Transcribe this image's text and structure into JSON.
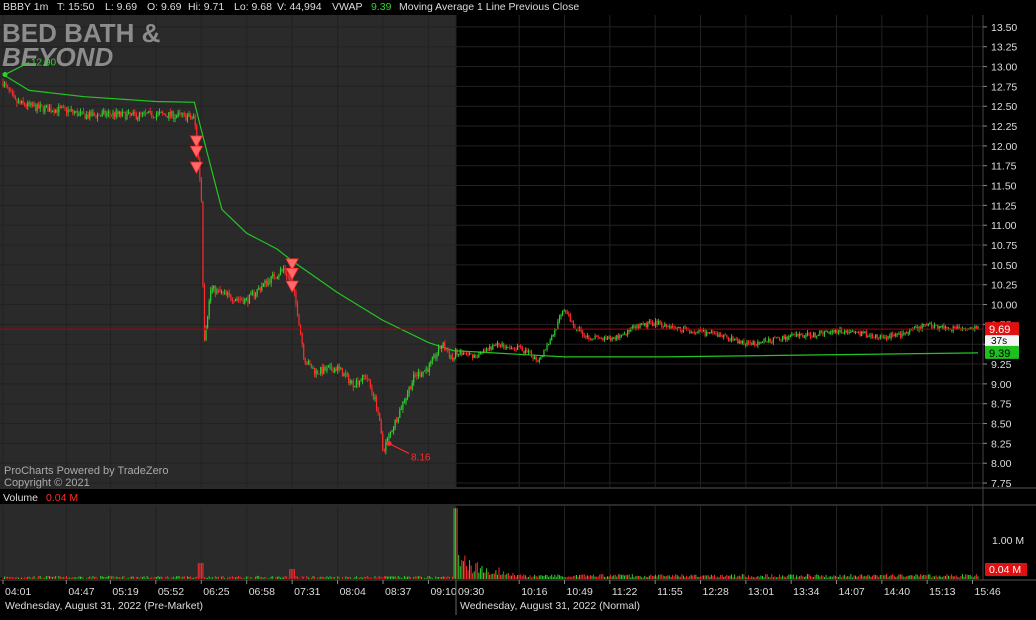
{
  "header": {
    "symbol": "BBBY 1m",
    "time": "T: 15:50",
    "low": "L: 9.69",
    "open": "O: 9.69",
    "high": "Hi: 9.71",
    "low2": "Lo: 9.68",
    "volume": "V: 44,994",
    "vwap_label": "VWAP",
    "vwap_value": "9.39",
    "indicators": "Moving Average 1 Line  Previous Close"
  },
  "logo": {
    "line1": "BED BATH &",
    "line2": "BEYOND"
  },
  "watermark": {
    "line1": "ProCharts Powered by TradeZero",
    "line2": "Copyright © 2021"
  },
  "volume_panel": {
    "label": "Volume",
    "value": "0.04 M",
    "axis_label": "1.00 M",
    "badge": "0.04 M"
  },
  "sessions": {
    "premarket": "Wednesday, August 31, 2022 (Pre-Market)",
    "normal": "Wednesday, August 31, 2022 (Normal)"
  },
  "price_badges": {
    "last": "9.69",
    "timer": "37s",
    "vwap": "9.39"
  },
  "annotations": {
    "high": "12.90",
    "low": "8.16"
  },
  "colors": {
    "up": "#2fd12f",
    "down": "#ff2b2b",
    "vwap": "#22c622",
    "premarket_bg": "#2a2a2a",
    "grid": "#222222",
    "last_line": "#b30000"
  },
  "chart_data": {
    "type": "candlestick",
    "x_ticks": [
      "04:01",
      "04:47",
      "05:19",
      "05:52",
      "06:25",
      "06:58",
      "07:31",
      "08:04",
      "08:37",
      "09:10",
      "09:30",
      "10:16",
      "10:49",
      "11:22",
      "11:55",
      "12:28",
      "13:01",
      "13:34",
      "14:07",
      "14:40",
      "15:13",
      "15:46"
    ],
    "y_ticks": [
      "13.50",
      "13.25",
      "13.00",
      "12.75",
      "12.50",
      "12.25",
      "12.00",
      "11.75",
      "11.50",
      "11.25",
      "11.00",
      "10.75",
      "10.50",
      "10.25",
      "10.00",
      "9.75",
      "9.50",
      "9.25",
      "9.00",
      "8.75",
      "8.50",
      "8.25",
      "8.00",
      "7.75"
    ],
    "ylim": [
      7.7,
      13.65
    ],
    "series": [
      {
        "name": "Price",
        "points": [
          [
            "04:01",
            12.8
          ],
          [
            "04:10",
            12.55
          ],
          [
            "04:25",
            12.48
          ],
          [
            "04:47",
            12.45
          ],
          [
            "05:00",
            12.38
          ],
          [
            "05:19",
            12.4
          ],
          [
            "05:35",
            12.38
          ],
          [
            "05:52",
            12.4
          ],
          [
            "06:10",
            12.38
          ],
          [
            "06:20",
            12.35
          ],
          [
            "06:23",
            11.8
          ],
          [
            "06:25",
            11.4
          ],
          [
            "06:27",
            9.55
          ],
          [
            "06:32",
            10.2
          ],
          [
            "06:45",
            10.1
          ],
          [
            "06:58",
            10.05
          ],
          [
            "07:10",
            10.25
          ],
          [
            "07:25",
            10.45
          ],
          [
            "07:31",
            10.25
          ],
          [
            "07:35",
            9.9
          ],
          [
            "07:40",
            9.3
          ],
          [
            "07:48",
            9.15
          ],
          [
            "08:04",
            9.2
          ],
          [
            "08:15",
            9.0
          ],
          [
            "08:25",
            9.1
          ],
          [
            "08:33",
            8.7
          ],
          [
            "08:37",
            8.16
          ],
          [
            "08:50",
            8.7
          ],
          [
            "09:00",
            9.1
          ],
          [
            "09:10",
            9.2
          ],
          [
            "09:20",
            9.5
          ],
          [
            "09:28",
            9.3
          ],
          [
            "09:30",
            9.4
          ],
          [
            "09:45",
            9.35
          ],
          [
            "10:00",
            9.5
          ],
          [
            "10:16",
            9.45
          ],
          [
            "10:30",
            9.3
          ],
          [
            "10:40",
            9.6
          ],
          [
            "10:49",
            9.95
          ],
          [
            "10:55",
            9.75
          ],
          [
            "11:05",
            9.6
          ],
          [
            "11:22",
            9.55
          ],
          [
            "11:40",
            9.7
          ],
          [
            "11:55",
            9.78
          ],
          [
            "12:10",
            9.7
          ],
          [
            "12:28",
            9.65
          ],
          [
            "12:45",
            9.6
          ],
          [
            "13:01",
            9.5
          ],
          [
            "13:20",
            9.55
          ],
          [
            "13:34",
            9.6
          ],
          [
            "13:50",
            9.62
          ],
          [
            "14:07",
            9.68
          ],
          [
            "14:20",
            9.65
          ],
          [
            "14:40",
            9.58
          ],
          [
            "15:00",
            9.65
          ],
          [
            "15:13",
            9.75
          ],
          [
            "15:30",
            9.7
          ],
          [
            "15:46",
            9.72
          ],
          [
            "15:50",
            9.69
          ]
        ]
      },
      {
        "name": "VWAP",
        "points": [
          [
            "04:01",
            12.9
          ],
          [
            "04:20",
            12.7
          ],
          [
            "05:00",
            12.62
          ],
          [
            "05:52",
            12.56
          ],
          [
            "06:20",
            12.55
          ],
          [
            "06:25",
            12.2
          ],
          [
            "06:40",
            11.2
          ],
          [
            "06:58",
            10.9
          ],
          [
            "07:20",
            10.7
          ],
          [
            "07:31",
            10.55
          ],
          [
            "08:04",
            10.15
          ],
          [
            "08:37",
            9.8
          ],
          [
            "09:10",
            9.52
          ],
          [
            "09:28",
            9.42
          ],
          [
            "10:49",
            9.34
          ],
          [
            "12:00",
            9.34
          ],
          [
            "15:50",
            9.39
          ]
        ]
      }
    ],
    "volume_ylim": [
      0,
      1.6
    ],
    "volume_unit": "M"
  }
}
